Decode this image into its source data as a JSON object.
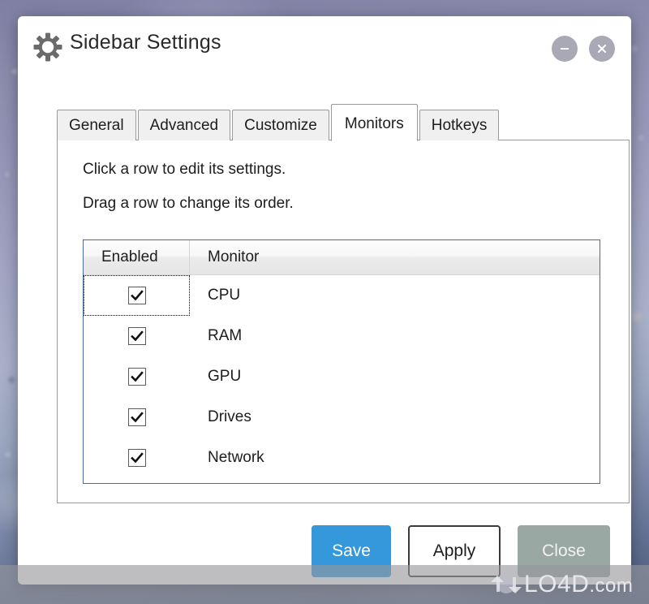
{
  "window": {
    "title": "Sidebar Settings",
    "icon": "gear-icon",
    "minimize_label": "–",
    "close_label": "✕"
  },
  "tabs": [
    {
      "label": "General",
      "active": false
    },
    {
      "label": "Advanced",
      "active": false
    },
    {
      "label": "Customize",
      "active": false
    },
    {
      "label": "Monitors",
      "active": true
    },
    {
      "label": "Hotkeys",
      "active": false
    }
  ],
  "panel": {
    "hints": [
      "Click a row to edit its settings.",
      "Drag a row to change its order."
    ],
    "table": {
      "columns": [
        "Enabled",
        "Monitor"
      ],
      "rows": [
        {
          "enabled": true,
          "name": "CPU",
          "focused": true
        },
        {
          "enabled": true,
          "name": "RAM",
          "focused": false
        },
        {
          "enabled": true,
          "name": "GPU",
          "focused": false
        },
        {
          "enabled": true,
          "name": "Drives",
          "focused": false
        },
        {
          "enabled": true,
          "name": "Network",
          "focused": false
        }
      ]
    }
  },
  "footer": {
    "save_label": "Save",
    "apply_label": "Apply",
    "close_label": "Close"
  },
  "watermark": {
    "text": "LO4D",
    "suffix": ".com"
  },
  "colors": {
    "accent_save": "#3498db",
    "close_button": "#9aa8a4",
    "table_border": "#4c6a94",
    "panel_border": "#9a9a9a",
    "titlebar_button": "#a9a9b6"
  }
}
